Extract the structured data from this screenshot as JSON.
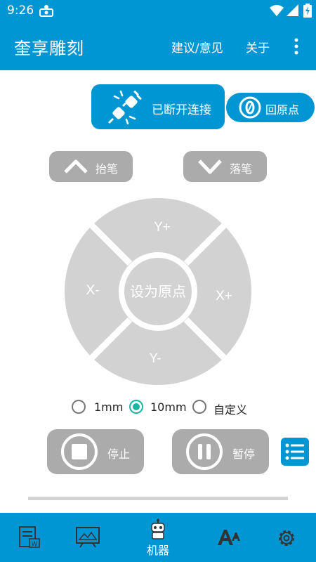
{
  "status_bar": {
    "time": "9:26"
  },
  "app_bar": {
    "title": "奎享雕刻",
    "menu_items": [
      "建议/意见",
      "关于"
    ]
  },
  "connection": {
    "status_label": "已断开连接",
    "home_label": "回原点"
  },
  "pen": {
    "up_label": "抬笔",
    "down_label": "落笔"
  },
  "dpad": {
    "up": "Y+",
    "down": "Y-",
    "left": "X-",
    "right": "X+",
    "center": "设为原点"
  },
  "step_options": [
    {
      "label": "1mm",
      "selected": false
    },
    {
      "label": "10mm",
      "selected": true
    },
    {
      "label": "自定义",
      "selected": false
    }
  ],
  "controls": {
    "stop_label": "停止",
    "pause_label": "暂停"
  },
  "bottom_nav": {
    "active_label": "机器"
  },
  "colors": {
    "primary": "#0096d4",
    "disabled": "#ababab",
    "pad": "#d2d2d2",
    "radio_accent": "#1ab5a5"
  }
}
